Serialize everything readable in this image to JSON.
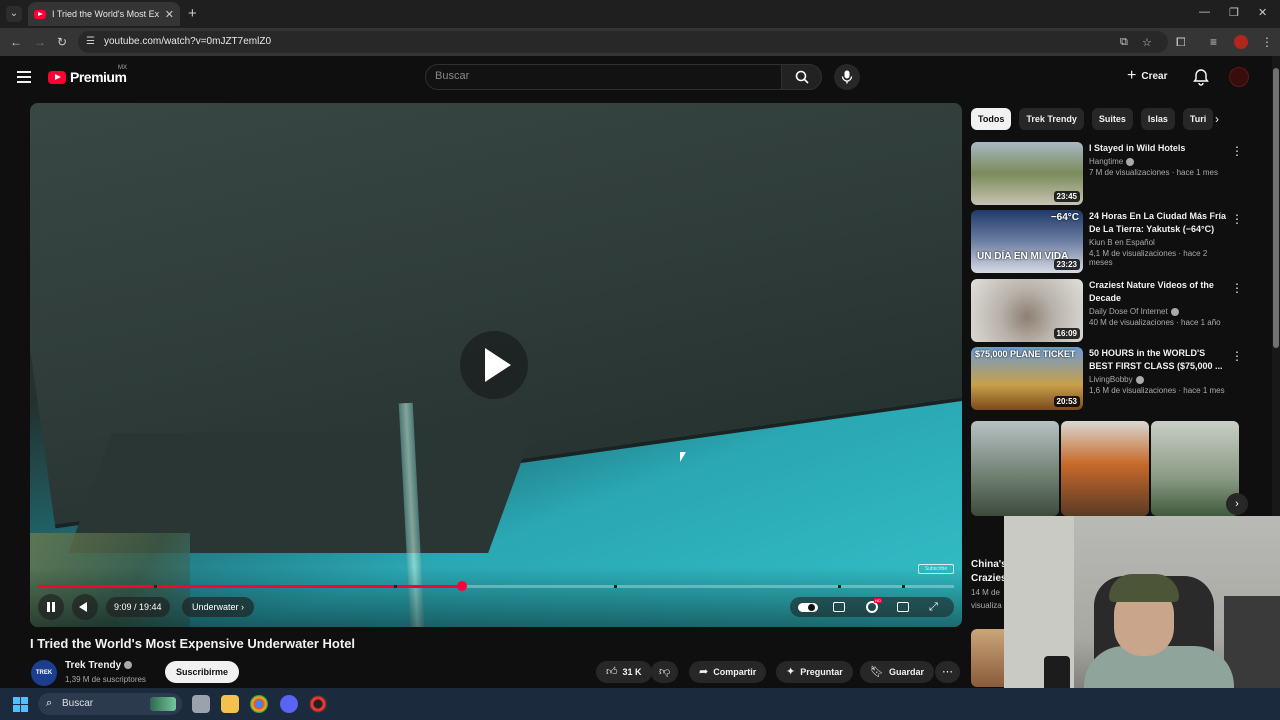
{
  "browser": {
    "tab_title": "I Tried the World's Most Expensive Underwater Hotel",
    "url": "youtube.com/watch?v=0mJZT7emlZ0"
  },
  "header": {
    "logo_text": "Premium",
    "country_code": "MX",
    "search_placeholder": "Buscar",
    "create_label": "Crear"
  },
  "player": {
    "time": "9:09 / 19:44",
    "chapter": "Underwater",
    "progress_fraction": 0.463,
    "buffer_fraction": 0.463,
    "watermark": "Subscribe"
  },
  "video": {
    "title": "I Tried the World's Most Expensive Underwater Hotel",
    "channel": "Trek Trendy",
    "channel_avatar_text": "TREK",
    "subscribers": "1,39 M de suscriptores",
    "subscribe_label": "Suscribirme",
    "likes": "31 K",
    "share_label": "Compartir",
    "ask_label": "Preguntar",
    "save_label": "Guardar"
  },
  "sidebar": {
    "chips": [
      "Todos",
      "Trek Trendy",
      "Suites",
      "Islas",
      "Turi"
    ],
    "recommendations": [
      {
        "title": "I Stayed in Wild Hotels",
        "channel": "Hangtime",
        "stats": "7 M de visualizaciones · hace 1 mes",
        "duration": "23:45",
        "thumb_text": ""
      },
      {
        "title": "24 Horas En La Ciudad Más Fría De La Tierra: Yakutsk (−64°C)",
        "channel": "Kiun B en Español",
        "stats": "4,1 M de visualizaciones · hace 2 meses",
        "duration": "23:23",
        "thumb_text": "UN DÍA EN MI VIDA"
      },
      {
        "title": "Craziest Nature Videos of the Decade",
        "channel": "Daily Dose Of Internet",
        "stats": "40 M de visualizaciones · hace 1 año",
        "duration": "16:09",
        "thumb_text": ""
      },
      {
        "title": "50 HOURS in the WORLD'S BEST FIRST CLASS ($75,000 ...",
        "channel": "LivingBobby",
        "stats": "1,6 M de visualizaciones · hace 1 mes",
        "duration": "20:53",
        "thumb_text": "$75,000 PLANE TICKET"
      }
    ],
    "yakutsk_temp": "−64°C",
    "partial_rec": {
      "title_1": "China's",
      "title_2": "Crazies",
      "stats_1": "14 M de",
      "stats_2": "visualiza"
    }
  },
  "taskbar": {
    "search_label": "Buscar"
  },
  "colors": {
    "youtube_red": "#ff0033",
    "background": "#0f0f0f",
    "chip_bg": "#272727"
  }
}
